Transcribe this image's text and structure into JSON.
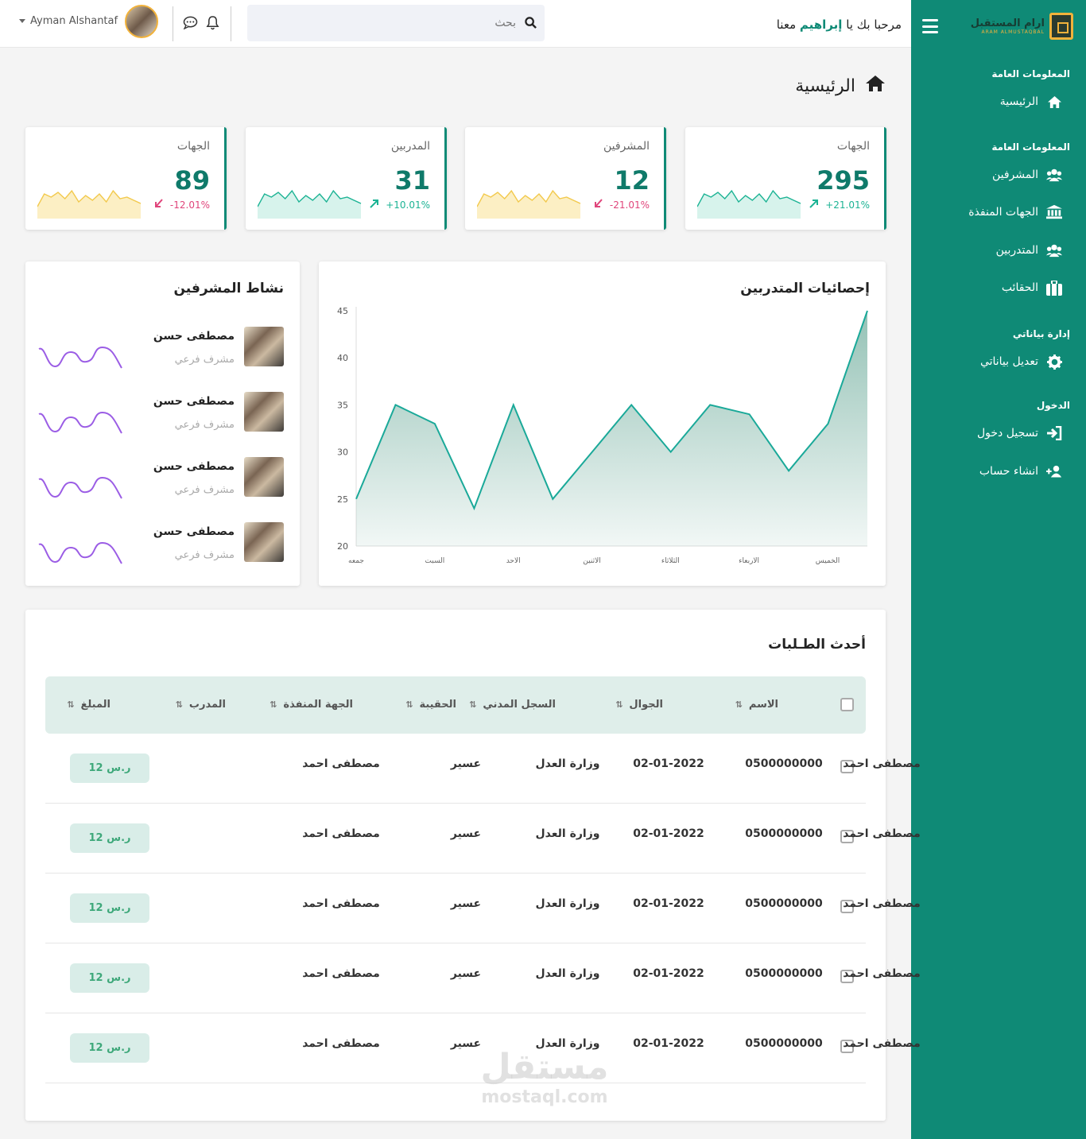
{
  "header": {
    "welcome_prefix": "مرحبا بك يا",
    "welcome_name": "إبراهيم",
    "welcome_suffix": "معنا",
    "search_placeholder": "بحث",
    "username": "Ayman Alshantaf"
  },
  "sidebar": {
    "logo_ar": "ارام المستقبل",
    "logo_en": "ARAM ALMUSTAQBAL",
    "sections": [
      {
        "label": "المعلومات العامة"
      },
      {
        "label": "المعلومات العامة"
      },
      {
        "label": "إدارة بياناتي"
      },
      {
        "label": "الدخول"
      }
    ],
    "items": [
      {
        "label": "الرئيسية",
        "icon": "home-icon"
      },
      {
        "label": "المشرفين",
        "icon": "users-icon"
      },
      {
        "label": "الجهات المنفذة",
        "icon": "bank-icon"
      },
      {
        "label": "المتدربين",
        "icon": "users-icon"
      },
      {
        "label": "الحقائب",
        "icon": "briefcase-icon"
      },
      {
        "label": "تعديل بياناتي",
        "icon": "gear-icon"
      },
      {
        "label": "تسجيل دخول",
        "icon": "login-icon"
      },
      {
        "label": "انشاء حساب",
        "icon": "user-plus-icon"
      }
    ]
  },
  "page_title": "الرئيسية",
  "stats": [
    {
      "title": "الجهات",
      "value": "295",
      "pct": "+21.01%",
      "trend": "up",
      "color": "#1cb394",
      "fill": "#d7f3ec"
    },
    {
      "title": "المشرفين",
      "value": "12",
      "pct": "-21.01%",
      "trend": "down",
      "color": "#f2c94c",
      "fill": "#fcefc4"
    },
    {
      "title": "المدربين",
      "value": "31",
      "pct": "+10.01%",
      "trend": "up",
      "color": "#1cb394",
      "fill": "#d7f3ec"
    },
    {
      "title": "الجهات",
      "value": "89",
      "pct": "-12.01%",
      "trend": "down",
      "color": "#f2c94c",
      "fill": "#fcefc4"
    }
  ],
  "supervisors": {
    "title": "نشاط المشرفين",
    "rows": [
      {
        "name": "مصطفى حسن",
        "role": "مشرف فرعي"
      },
      {
        "name": "مصطفى حسن",
        "role": "مشرف فرعي"
      },
      {
        "name": "مصطفى حسن",
        "role": "مشرف فرعي"
      },
      {
        "name": "مصطفى حسن",
        "role": "مشرف فرعي"
      }
    ]
  },
  "chart_title": "إحصائيات المتدربين",
  "chart_data": {
    "type": "area",
    "title": "إحصائيات المتدربين",
    "x": [
      "جمعه",
      "السبت",
      "الاحد",
      "الاثنين",
      "الثلاثاء",
      "الاربعاء",
      "الخميس"
    ],
    "values": [
      25,
      35,
      33,
      24,
      35,
      25,
      30,
      35,
      30,
      35,
      34,
      28,
      33,
      45
    ],
    "ylim": [
      20,
      45
    ],
    "yticks": [
      "20",
      "25",
      "30",
      "35",
      "40",
      "45"
    ],
    "grid": false,
    "line_color": "#1aa999"
  },
  "table": {
    "title": "أحدث الطـلبات",
    "columns": [
      "الاسم",
      "الجوال",
      "السجل المدني",
      "الحقيبة",
      "الجهة المنفذة",
      "المدرب",
      "المبلغ"
    ],
    "rows": [
      [
        "مصطفى احمد",
        "0500000000",
        "02-01-2022",
        "وزارة العدل",
        "عسير",
        "مصطفى احمد",
        "12 ر.س"
      ],
      [
        "مصطفى احمد",
        "0500000000",
        "02-01-2022",
        "وزارة العدل",
        "عسير",
        "مصطفى احمد",
        "12 ر.س"
      ],
      [
        "مصطفى احمد",
        "0500000000",
        "02-01-2022",
        "وزارة العدل",
        "عسير",
        "مصطفى احمد",
        "12 ر.س"
      ],
      [
        "مصطفى احمد",
        "0500000000",
        "02-01-2022",
        "وزارة العدل",
        "عسير",
        "مصطفى احمد",
        "12 ر.س"
      ],
      [
        "مصطفى احمد",
        "0500000000",
        "02-01-2022",
        "وزارة العدل",
        "عسير",
        "مصطفى احمد",
        "12 ر.س"
      ]
    ]
  },
  "watermark": {
    "ar": "مستقل",
    "en": "mostaql.com"
  },
  "colors": {
    "brand": "#0f8a76",
    "accent": "#f1b23b",
    "positive": "#1cb394",
    "negative": "#e0457b"
  }
}
